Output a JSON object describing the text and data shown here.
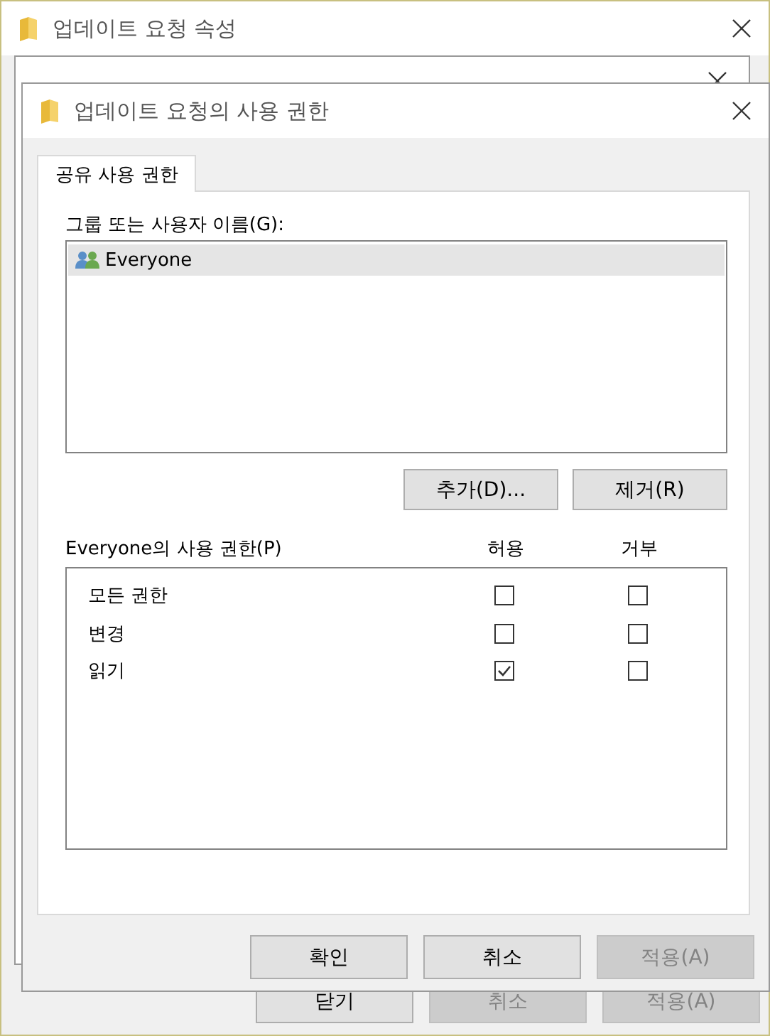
{
  "back_window": {
    "title": "업데이트 요청 속성",
    "buttons": [
      {
        "label": "닫기",
        "disabled": false
      },
      {
        "label": "취소",
        "disabled": true
      },
      {
        "label": "적용(A)",
        "disabled": true
      }
    ]
  },
  "dialog": {
    "title": "업데이트 요청의 사용 권한",
    "tabs": [
      {
        "label": "공유 사용 권한",
        "selected": true
      }
    ],
    "group_label": "그룹 또는 사용자 이름(G):",
    "users": [
      {
        "name": "Everyone",
        "selected": true
      }
    ],
    "user_buttons": [
      "추가(D)...",
      "제거(R)"
    ],
    "permissions_label": "Everyone의 사용 권한(P)",
    "columns": [
      "허용",
      "거부"
    ],
    "permissions": [
      {
        "name": "모든 권한",
        "allow": false,
        "deny": false
      },
      {
        "name": "변경",
        "allow": false,
        "deny": false
      },
      {
        "name": "읽기",
        "allow": true,
        "deny": false
      }
    ],
    "buttons": [
      {
        "label": "확인",
        "disabled": false
      },
      {
        "label": "취소",
        "disabled": false
      },
      {
        "label": "적용(A)",
        "disabled": true
      }
    ]
  }
}
